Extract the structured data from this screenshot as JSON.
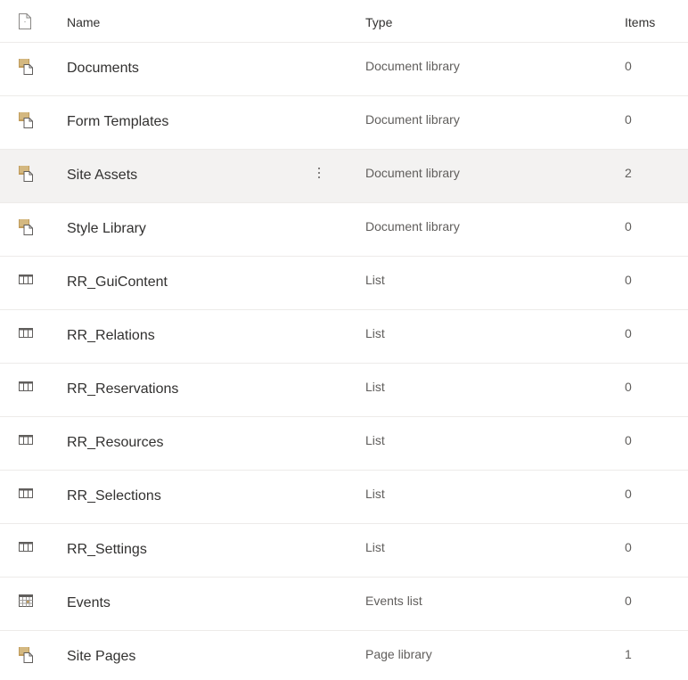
{
  "header": {
    "name": "Name",
    "type": "Type",
    "items": "Items"
  },
  "rows": [
    {
      "name": "Documents",
      "type": "Document library",
      "items": "0",
      "icon": "document-library-icon"
    },
    {
      "name": "Form Templates",
      "type": "Document library",
      "items": "0",
      "icon": "document-library-icon"
    },
    {
      "name": "Site Assets",
      "type": "Document library",
      "items": "2",
      "icon": "document-library-icon",
      "selected": true
    },
    {
      "name": "Style Library",
      "type": "Document library",
      "items": "0",
      "icon": "document-library-icon"
    },
    {
      "name": "RR_GuiContent",
      "type": "List",
      "items": "0",
      "icon": "list-icon"
    },
    {
      "name": "RR_Relations",
      "type": "List",
      "items": "0",
      "icon": "list-icon"
    },
    {
      "name": "RR_Reservations",
      "type": "List",
      "items": "0",
      "icon": "list-icon"
    },
    {
      "name": "RR_Resources",
      "type": "List",
      "items": "0",
      "icon": "list-icon"
    },
    {
      "name": "RR_Selections",
      "type": "List",
      "items": "0",
      "icon": "list-icon"
    },
    {
      "name": "RR_Settings",
      "type": "List",
      "items": "0",
      "icon": "list-icon"
    },
    {
      "name": "Events",
      "type": "Events list",
      "items": "0",
      "icon": "calendar-icon"
    },
    {
      "name": "Site Pages",
      "type": "Page library",
      "items": "1",
      "icon": "document-library-icon"
    }
  ],
  "colors": {
    "library_icon": "#c19c5b",
    "list_icon": "#605e5c",
    "selected_row": "#f3f2f1"
  }
}
